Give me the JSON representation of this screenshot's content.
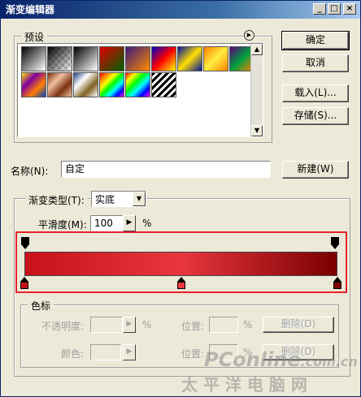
{
  "window": {
    "title": "渐变编辑器",
    "controls": [
      "_",
      "□",
      "×"
    ]
  },
  "presets": {
    "legend": "预设",
    "menu_icon": "circle-arrow-right-icon",
    "swatches": [
      {
        "name": "preset-foreground-to-background",
        "css": "linear-gradient(135deg,#000,#fff)"
      },
      {
        "name": "preset-foreground-to-transparent",
        "css": "linear-gradient(135deg,#000 0%,rgba(0,0,0,0) 100%),repeating-conic-gradient(#ccc 0 25%,#fff 0 50%) 0 0/8px 8px"
      },
      {
        "name": "preset-black-white",
        "css": "linear-gradient(135deg,#000,#fff)"
      },
      {
        "name": "preset-red-green",
        "css": "linear-gradient(135deg,#e00000,#006000)"
      },
      {
        "name": "preset-violet-orange",
        "css": "linear-gradient(135deg,#3a1a7a,#ff8a00)"
      },
      {
        "name": "preset-blue-red-yellow",
        "css": "linear-gradient(135deg,#0000c0,#ff0000,#ffff00)"
      },
      {
        "name": "preset-blue-yellow-blue",
        "css": "linear-gradient(135deg,#0010a0,#ffe000,#0010a0)"
      },
      {
        "name": "preset-orange-yellow-orange",
        "css": "linear-gradient(135deg,#ff8000,#ffee40,#ff8000)"
      },
      {
        "name": "preset-violet-green-orange",
        "css": "linear-gradient(135deg,#5a007a,#00a040,#ff8000)"
      },
      {
        "name": "preset-yellow-violet-orange-blue",
        "css": "linear-gradient(135deg,#ffe000,#8000a0,#ff8000,#0040c0)"
      },
      {
        "name": "preset-copper",
        "css": "linear-gradient(135deg,#7a3010,#f0c0a0,#7a3010,#f0c0a0)"
      },
      {
        "name": "preset-chrome",
        "css": "linear-gradient(135deg,#204080,#fff,#806020,#fff)"
      },
      {
        "name": "preset-spectrum",
        "css": "linear-gradient(135deg,#ff0000,#ff8000,#ffff00,#00ff00,#00ffff,#0000ff,#ff00ff)"
      },
      {
        "name": "preset-transparent-rainbow",
        "css": "linear-gradient(135deg,#ff0000,#ffff00,#00ff00,#00ffff,#0000ff,#ff00ff),#fff"
      },
      {
        "name": "preset-transparent-stripes",
        "css": "repeating-linear-gradient(135deg,#000 0 3px,#fff 3px 6px)"
      }
    ]
  },
  "buttons": {
    "ok": "确定",
    "cancel": "取消",
    "load": "载入(L)...",
    "save": "存储(S)...",
    "new": "新建(W)"
  },
  "name_row": {
    "label": "名称(N):",
    "value": "自定"
  },
  "type_group": {
    "type_label": "渐变类型(T):",
    "type_value": "实底",
    "smooth_label": "平滑度(M):",
    "smooth_value": "100",
    "smooth_unit": "%"
  },
  "gradient": {
    "stops_css": "linear-gradient(to right,#c8111a 0%,#e8363f 50%,#7a0000 100%)",
    "opacity_stops": [
      "#000000",
      "#000000"
    ],
    "color_stops": [
      {
        "color": "#c8111a",
        "location_percent": 0
      },
      {
        "color": "#e8363f",
        "location_percent": 50
      },
      {
        "color": "#7a0000",
        "location_percent": 100
      }
    ],
    "highlight_color": "#e8202a"
  },
  "color_stop_panel": {
    "legend": "色标",
    "opacity_label": "不透明度:",
    "opacity_unit": "%",
    "position_label_1": "位置:",
    "position_unit_1": "%",
    "delete_1": "删除(D)",
    "color_label": "颜色:",
    "position_label_2": "位置:",
    "position_unit_2": "%",
    "delete_2": "删除(D)"
  },
  "watermark": {
    "brand": "PConline",
    "brand_suffix": ".com.cn",
    "cn": "太 平 洋 电 脑 网"
  }
}
